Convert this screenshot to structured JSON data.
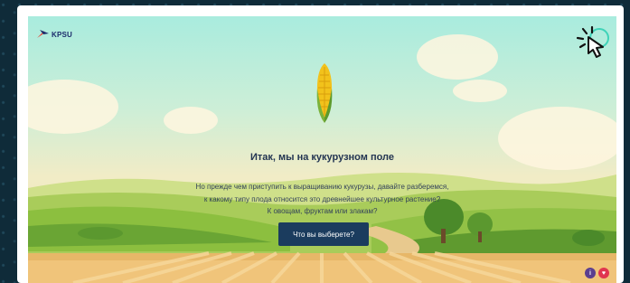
{
  "brand": {
    "logo_text": "KPSU"
  },
  "intro": {
    "title": "Итак, мы на кукурузном поле",
    "paragraph_lines": [
      "Но прежде чем приступить к выращиванию кукурузы, давайте разберемся,",
      "к какому типу плода относится это древнейшее культурное растение?",
      "К овощам, фруктам или злакам?"
    ],
    "cta_label": "Что вы выберете?"
  },
  "colors": {
    "button": "#1b3c5e",
    "info_badge": "#5b3f8f",
    "heart_badge": "#e0354f"
  },
  "icons": {
    "cursor": "click-cursor-icon",
    "corn": "corn-icon",
    "info": "info-icon",
    "heart": "heart-icon"
  }
}
